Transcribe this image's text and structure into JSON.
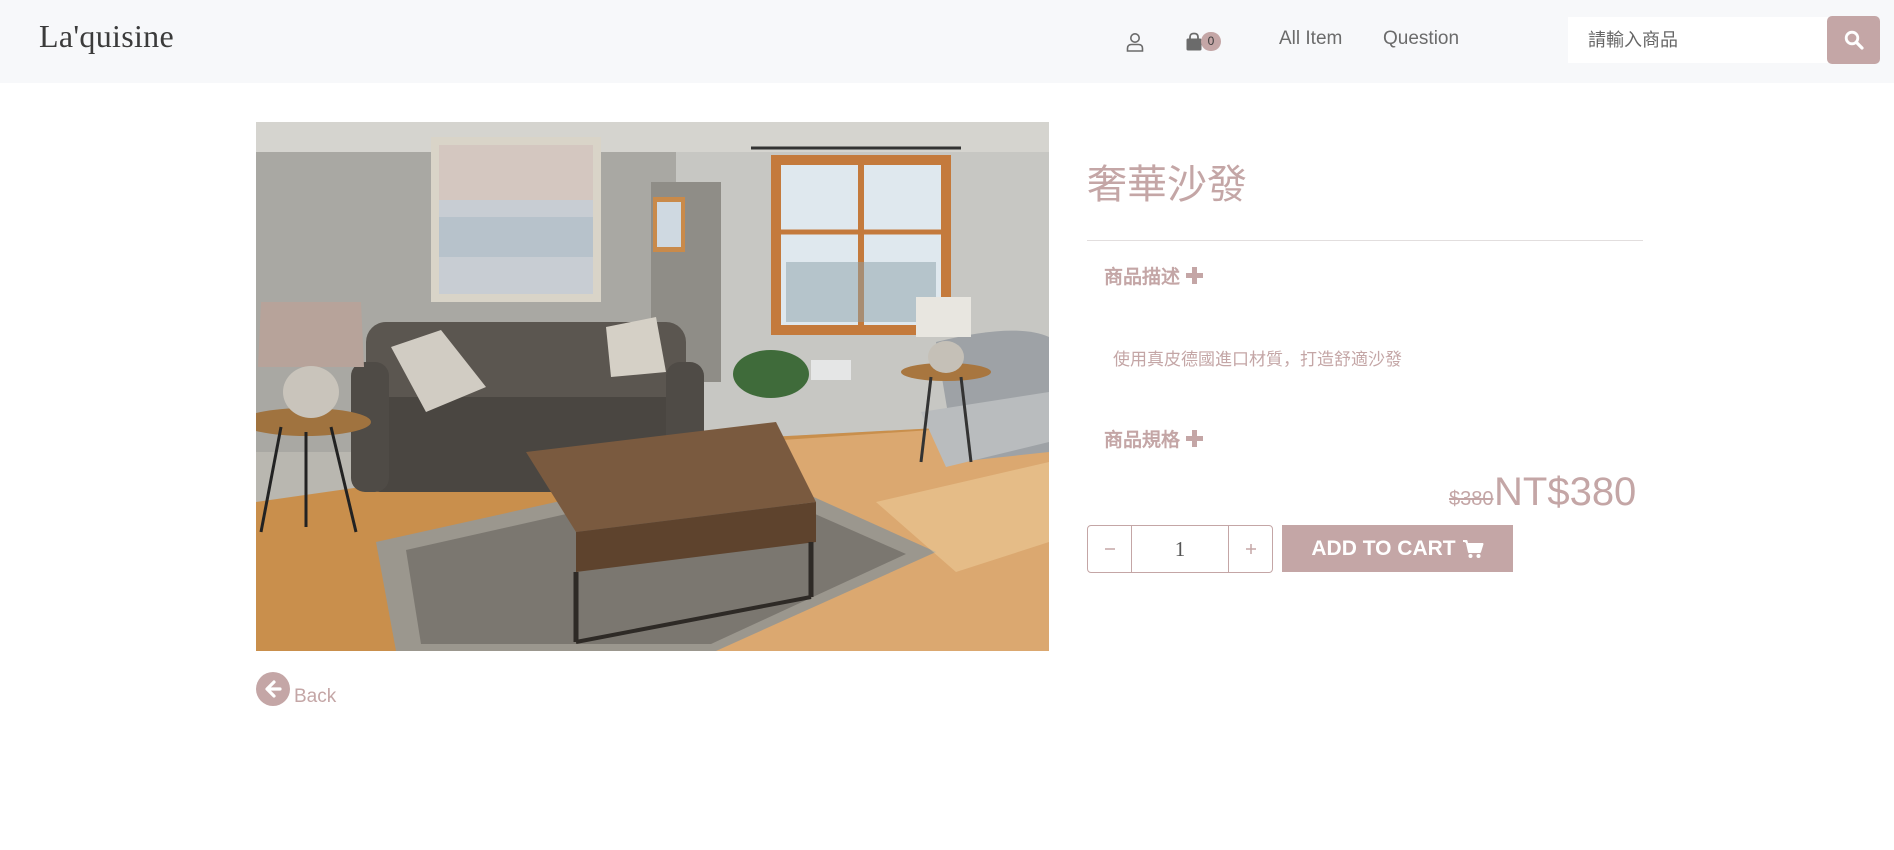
{
  "nav": {
    "brand": "La'quisine",
    "cart_count": "0",
    "links": [
      "All Item",
      "Question"
    ],
    "search_placeholder": "請輸入商品"
  },
  "product": {
    "title": "奢華沙發",
    "description_heading": "商品描述",
    "description_text": "使用真皮德國進口材質，打造舒適沙發",
    "spec_heading": "商品規格",
    "original_price": "$380",
    "price": "NT$380",
    "quantity": "1",
    "add_to_cart_label": "ADD TO CART"
  },
  "back_label": "Back",
  "icons": {
    "user": "user-icon",
    "bag": "shopping-bag-icon",
    "search": "search-icon",
    "cart": "cart-icon",
    "back": "arrow-left-circle-icon"
  },
  "colors": {
    "accent": "#c4a6a6",
    "navbar_bg": "#f7f8fa"
  }
}
